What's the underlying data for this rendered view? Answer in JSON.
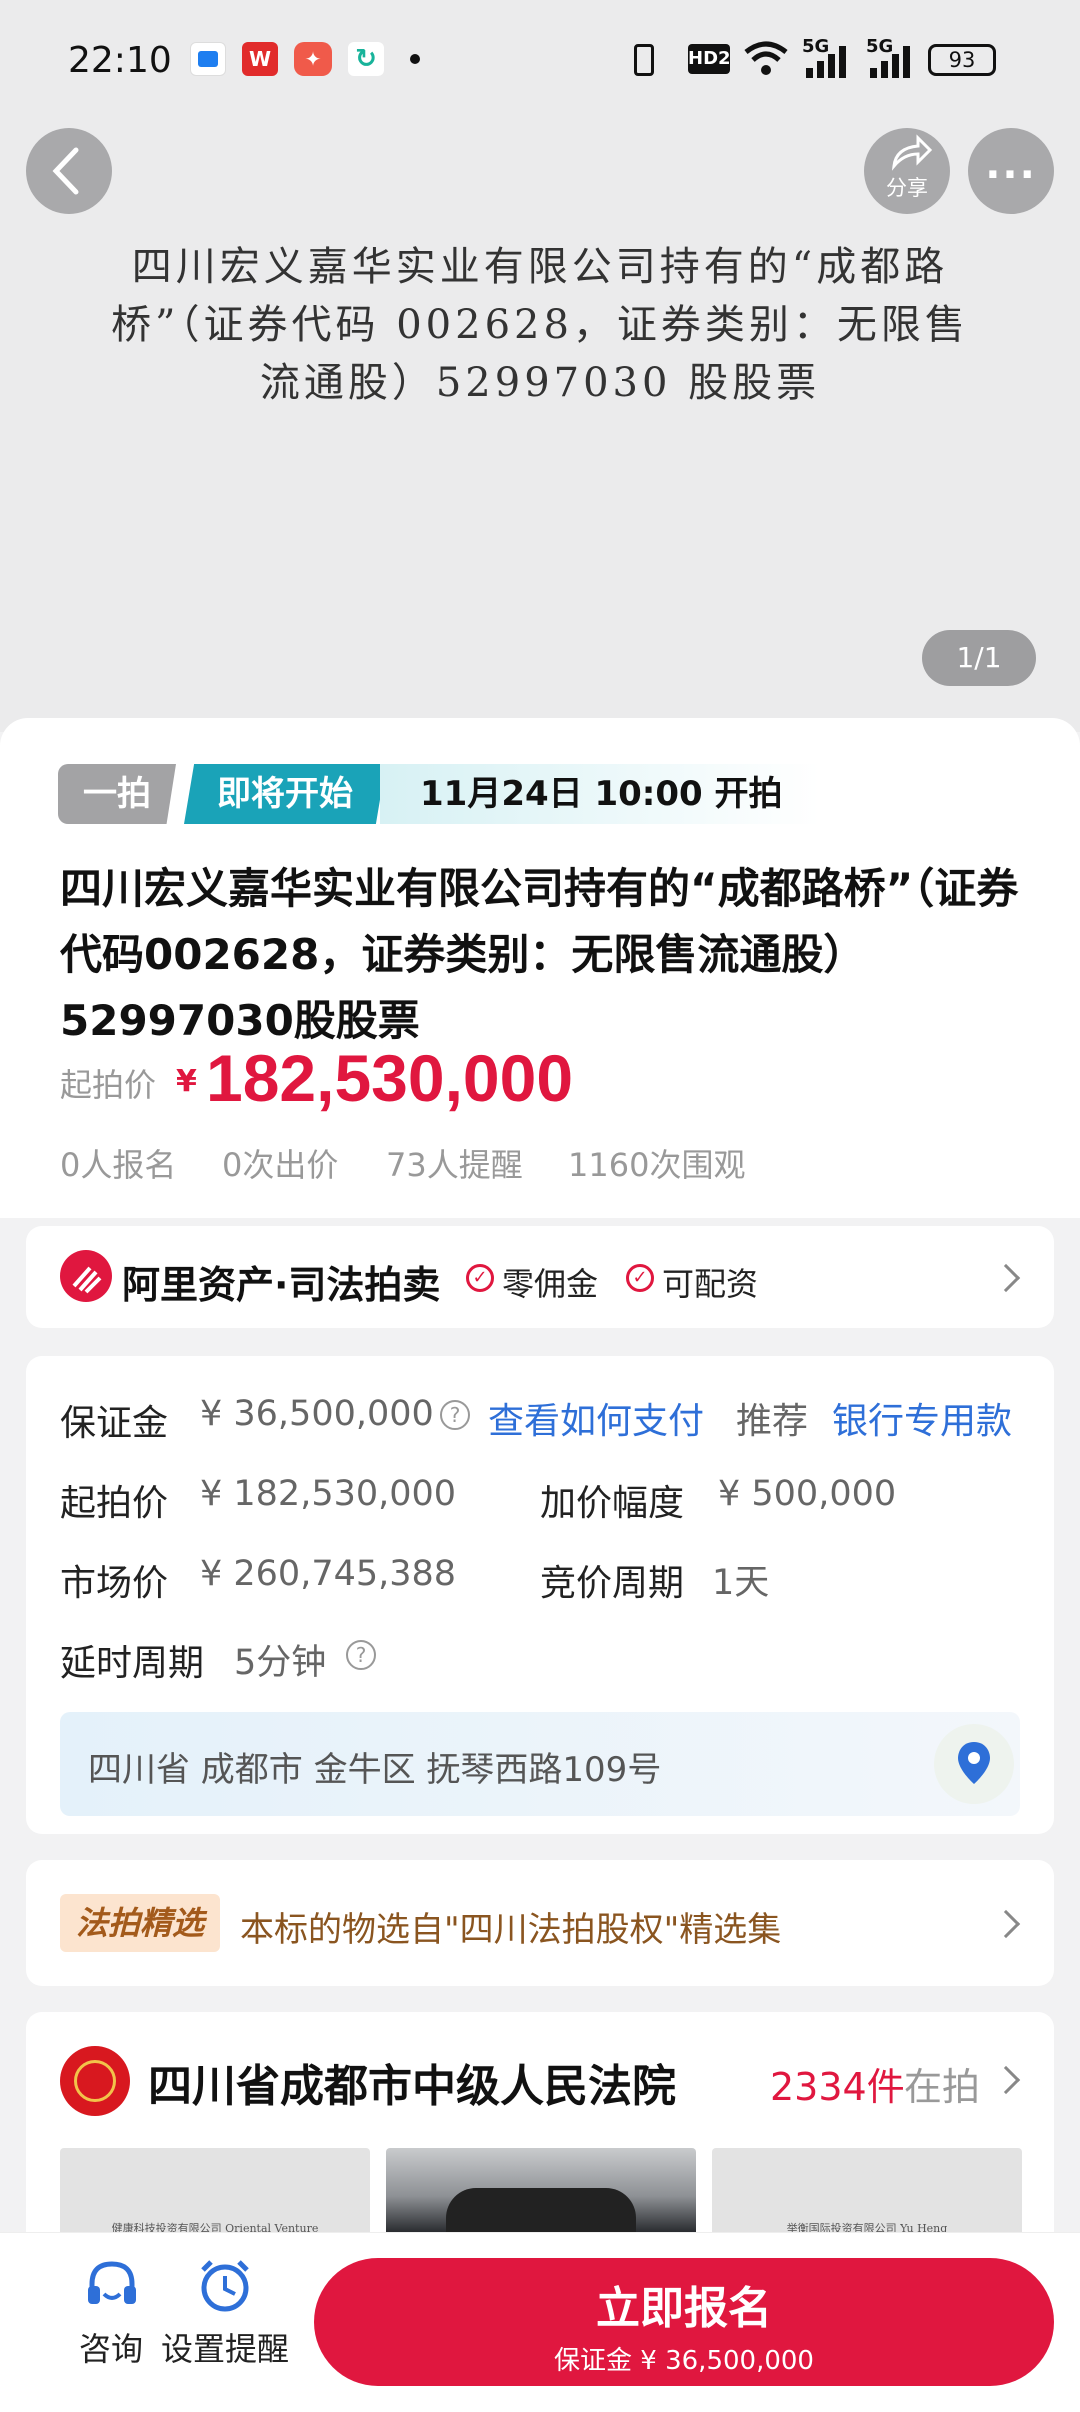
{
  "status_bar": {
    "time": "22:10",
    "app_icons": [
      "chat-app-icon",
      "wps-icon",
      "app-notification-icon",
      "refresh-app-icon"
    ],
    "right_labels": [
      "HD2",
      "5G",
      "5G"
    ],
    "battery": "93"
  },
  "header": {
    "share_label": "分享"
  },
  "hero": {
    "text": "四川宏义嘉华实业有限公司持有的“成都路桥”（证券代码 002628，证券类别：无限售流通股）52997030 股股票",
    "pager": "1/1"
  },
  "auction": {
    "round_tag": "一拍",
    "status_tag": "即将开始",
    "start_time": "11月24日 10:00 开拍",
    "title": "四川宏义嘉华实业有限公司持有的“成都路桥”（证券代码002628，证券类别：无限售流通股）52997030股股票",
    "start_price_label": "起拍价",
    "currency": "¥",
    "start_price": "182,530,000",
    "stats": [
      "0人报名",
      "0次出价",
      "73人提醒",
      "1160次围观"
    ]
  },
  "platform": {
    "name": "阿里资产·司法拍卖",
    "badges": [
      "零佣金",
      "可配资"
    ]
  },
  "details": {
    "deposit_label": "保证金",
    "deposit_value": "¥ 36,500,000",
    "how_to_pay": "查看如何支付",
    "recommend_label": "推荐",
    "bank_link": "银行专用款",
    "rows": [
      {
        "label": "起拍价",
        "value": "¥ 182,530,000"
      },
      {
        "label": "加价幅度",
        "value": "¥ 500,000"
      },
      {
        "label": "市场价",
        "value": "¥ 260,745,388"
      },
      {
        "label": "竞价周期",
        "value": "1天"
      },
      {
        "label": "延时周期",
        "value": "5分钟"
      }
    ],
    "address": "四川省 成都市 金牛区 抚琴西路109号"
  },
  "selection": {
    "badge": "法拍精选",
    "text": "本标的物选自\"四川法拍股权\"精选集"
  },
  "court": {
    "name": "四川省成都市中级人民法院",
    "count": "2334件",
    "count_suffix": "在拍",
    "thumbs": [
      "健康科技投资有限公司 Oriental Venture",
      "",
      "举衡国际投资有限公司 Yu Heng"
    ]
  },
  "bottom_bar": {
    "consult": "咨询",
    "remind": "设置提醒",
    "cta": "立即报名",
    "cta_sub": "保证金 ¥ 36,500,000"
  },
  "colors": {
    "accent_red": "#e0173f",
    "teal": "#1aa3b8",
    "blue_link": "#2e6fd8",
    "gray_tag": "#a3a3a5",
    "selection_brown": "#8a5520"
  }
}
